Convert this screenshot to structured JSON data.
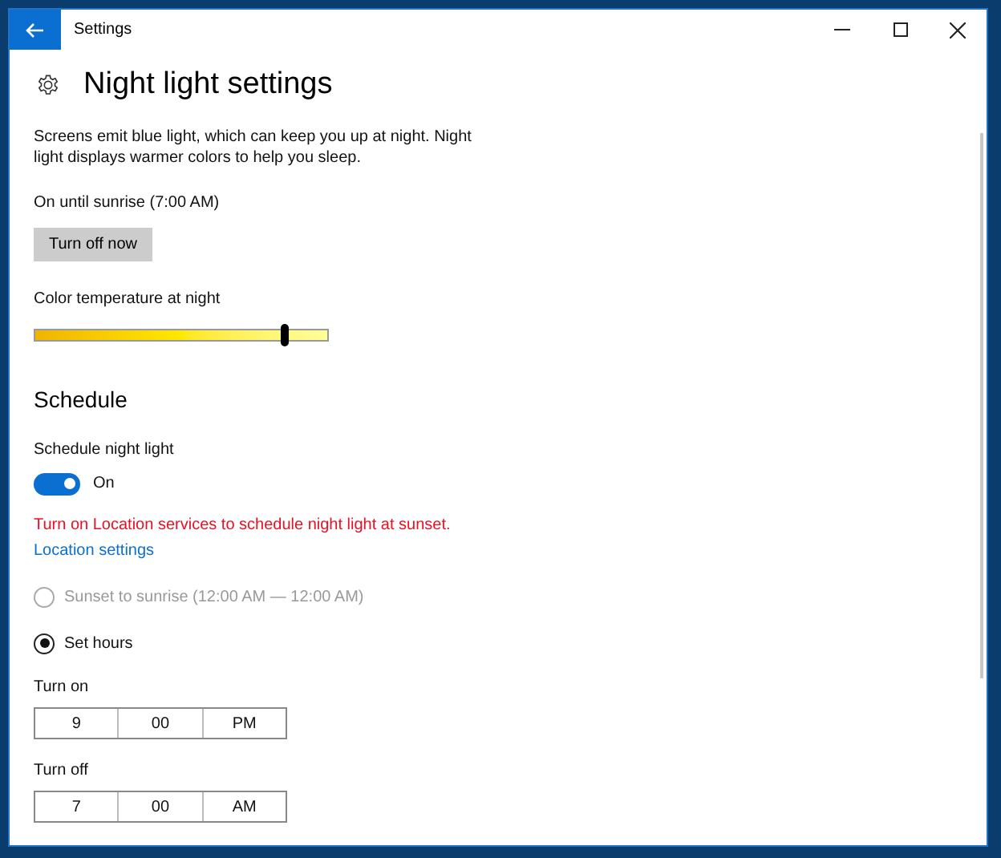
{
  "window": {
    "title": "Settings"
  },
  "page": {
    "title": "Night light settings",
    "description": "Screens emit blue light, which can keep you up at night. Night light displays warmer colors to help you sleep.",
    "status": "On until sunrise (7:00 AM)",
    "button": "Turn off now"
  },
  "color_temperature": {
    "label": "Color temperature at night",
    "level": 0.85
  },
  "schedule": {
    "heading": "Schedule",
    "toggle_label": "Schedule night light",
    "toggle": {
      "on": true,
      "label": "On"
    },
    "warning": "Turn on Location services to schedule night light at sunset.",
    "link": "Location settings",
    "options": [
      {
        "label": "Sunset to sunrise (12:00 AM — 12:00 AM)",
        "selected": false,
        "disabled": true
      },
      {
        "label": "Set hours",
        "selected": true,
        "disabled": false
      }
    ],
    "times": [
      {
        "label": "Turn on",
        "fields": [
          "9",
          "00",
          "PM"
        ]
      },
      {
        "label": "Turn off",
        "fields": [
          "7",
          "00",
          "AM"
        ]
      }
    ]
  }
}
